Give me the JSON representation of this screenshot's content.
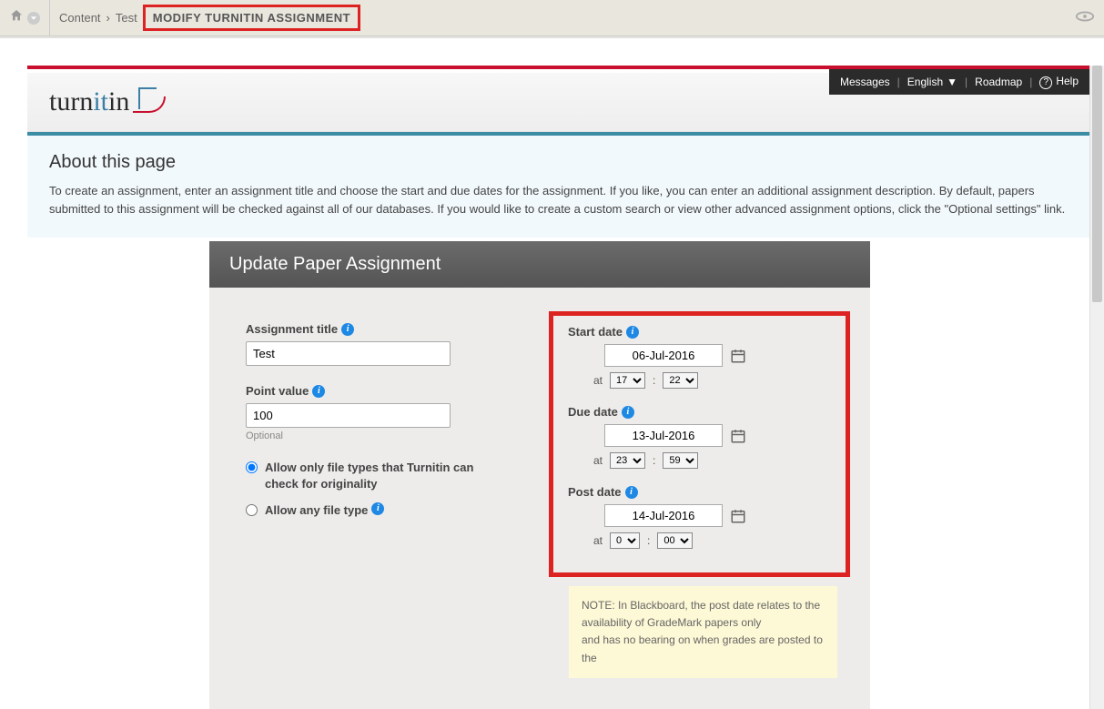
{
  "breadcrumbs": {
    "item1": "Content",
    "item2": "Test",
    "current": "MODIFY TURNITIN ASSIGNMENT"
  },
  "utilbar": {
    "messages": "Messages",
    "language": "English",
    "roadmap": "Roadmap",
    "help": "Help"
  },
  "logo": {
    "t": "turn",
    "i": "it",
    "n": "in"
  },
  "about": {
    "heading": "About this page",
    "body": "To create an assignment, enter an assignment title and choose the start and due dates for the assignment. If you like, you can enter an additional assignment description. By default, papers submitted to this assignment will be checked against all of our databases. If you would like to create a custom search or view other advanced assignment options, click the \"Optional settings\" link."
  },
  "form": {
    "header": "Update Paper Assignment",
    "title_label": "Assignment title",
    "title_value": "Test",
    "points_label": "Point value",
    "points_value": "100",
    "points_helper": "Optional",
    "radio_only_label": "Allow only file types that Turnitin can check for originality",
    "radio_any_label": "Allow any file type",
    "start": {
      "label": "Start date",
      "value": "06-Jul-2016",
      "at": "at",
      "hour": "17",
      "min": "22"
    },
    "due": {
      "label": "Due date",
      "value": "13-Jul-2016",
      "at": "at",
      "hour": "23",
      "min": "59"
    },
    "post": {
      "label": "Post date",
      "value": "14-Jul-2016",
      "at": "at",
      "hour": "0",
      "min": "00"
    },
    "note_l1": "NOTE: In Blackboard, the post date relates to the availability of GradeMark papers only",
    "note_l2": "and has no bearing on when grades are posted to the"
  }
}
